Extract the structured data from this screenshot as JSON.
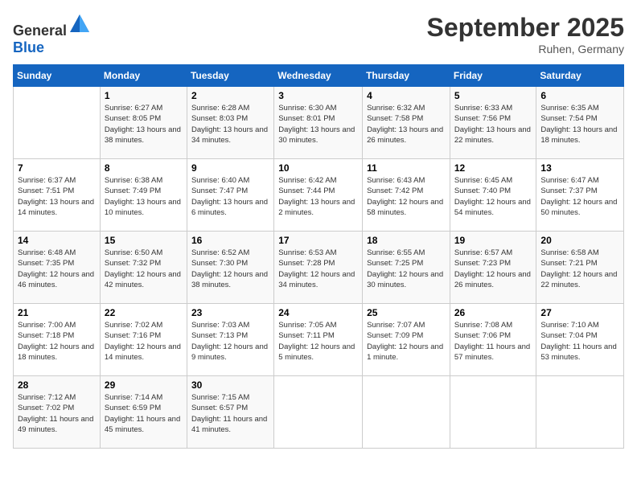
{
  "header": {
    "logo_general": "General",
    "logo_blue": "Blue",
    "month": "September 2025",
    "location": "Ruhen, Germany"
  },
  "days_of_week": [
    "Sunday",
    "Monday",
    "Tuesday",
    "Wednesday",
    "Thursday",
    "Friday",
    "Saturday"
  ],
  "weeks": [
    [
      {
        "day": "",
        "sunrise": "",
        "sunset": "",
        "daylight": ""
      },
      {
        "day": "1",
        "sunrise": "Sunrise: 6:27 AM",
        "sunset": "Sunset: 8:05 PM",
        "daylight": "Daylight: 13 hours and 38 minutes."
      },
      {
        "day": "2",
        "sunrise": "Sunrise: 6:28 AM",
        "sunset": "Sunset: 8:03 PM",
        "daylight": "Daylight: 13 hours and 34 minutes."
      },
      {
        "day": "3",
        "sunrise": "Sunrise: 6:30 AM",
        "sunset": "Sunset: 8:01 PM",
        "daylight": "Daylight: 13 hours and 30 minutes."
      },
      {
        "day": "4",
        "sunrise": "Sunrise: 6:32 AM",
        "sunset": "Sunset: 7:58 PM",
        "daylight": "Daylight: 13 hours and 26 minutes."
      },
      {
        "day": "5",
        "sunrise": "Sunrise: 6:33 AM",
        "sunset": "Sunset: 7:56 PM",
        "daylight": "Daylight: 13 hours and 22 minutes."
      },
      {
        "day": "6",
        "sunrise": "Sunrise: 6:35 AM",
        "sunset": "Sunset: 7:54 PM",
        "daylight": "Daylight: 13 hours and 18 minutes."
      }
    ],
    [
      {
        "day": "7",
        "sunrise": "Sunrise: 6:37 AM",
        "sunset": "Sunset: 7:51 PM",
        "daylight": "Daylight: 13 hours and 14 minutes."
      },
      {
        "day": "8",
        "sunrise": "Sunrise: 6:38 AM",
        "sunset": "Sunset: 7:49 PM",
        "daylight": "Daylight: 13 hours and 10 minutes."
      },
      {
        "day": "9",
        "sunrise": "Sunrise: 6:40 AM",
        "sunset": "Sunset: 7:47 PM",
        "daylight": "Daylight: 13 hours and 6 minutes."
      },
      {
        "day": "10",
        "sunrise": "Sunrise: 6:42 AM",
        "sunset": "Sunset: 7:44 PM",
        "daylight": "Daylight: 13 hours and 2 minutes."
      },
      {
        "day": "11",
        "sunrise": "Sunrise: 6:43 AM",
        "sunset": "Sunset: 7:42 PM",
        "daylight": "Daylight: 12 hours and 58 minutes."
      },
      {
        "day": "12",
        "sunrise": "Sunrise: 6:45 AM",
        "sunset": "Sunset: 7:40 PM",
        "daylight": "Daylight: 12 hours and 54 minutes."
      },
      {
        "day": "13",
        "sunrise": "Sunrise: 6:47 AM",
        "sunset": "Sunset: 7:37 PM",
        "daylight": "Daylight: 12 hours and 50 minutes."
      }
    ],
    [
      {
        "day": "14",
        "sunrise": "Sunrise: 6:48 AM",
        "sunset": "Sunset: 7:35 PM",
        "daylight": "Daylight: 12 hours and 46 minutes."
      },
      {
        "day": "15",
        "sunrise": "Sunrise: 6:50 AM",
        "sunset": "Sunset: 7:32 PM",
        "daylight": "Daylight: 12 hours and 42 minutes."
      },
      {
        "day": "16",
        "sunrise": "Sunrise: 6:52 AM",
        "sunset": "Sunset: 7:30 PM",
        "daylight": "Daylight: 12 hours and 38 minutes."
      },
      {
        "day": "17",
        "sunrise": "Sunrise: 6:53 AM",
        "sunset": "Sunset: 7:28 PM",
        "daylight": "Daylight: 12 hours and 34 minutes."
      },
      {
        "day": "18",
        "sunrise": "Sunrise: 6:55 AM",
        "sunset": "Sunset: 7:25 PM",
        "daylight": "Daylight: 12 hours and 30 minutes."
      },
      {
        "day": "19",
        "sunrise": "Sunrise: 6:57 AM",
        "sunset": "Sunset: 7:23 PM",
        "daylight": "Daylight: 12 hours and 26 minutes."
      },
      {
        "day": "20",
        "sunrise": "Sunrise: 6:58 AM",
        "sunset": "Sunset: 7:21 PM",
        "daylight": "Daylight: 12 hours and 22 minutes."
      }
    ],
    [
      {
        "day": "21",
        "sunrise": "Sunrise: 7:00 AM",
        "sunset": "Sunset: 7:18 PM",
        "daylight": "Daylight: 12 hours and 18 minutes."
      },
      {
        "day": "22",
        "sunrise": "Sunrise: 7:02 AM",
        "sunset": "Sunset: 7:16 PM",
        "daylight": "Daylight: 12 hours and 14 minutes."
      },
      {
        "day": "23",
        "sunrise": "Sunrise: 7:03 AM",
        "sunset": "Sunset: 7:13 PM",
        "daylight": "Daylight: 12 hours and 9 minutes."
      },
      {
        "day": "24",
        "sunrise": "Sunrise: 7:05 AM",
        "sunset": "Sunset: 7:11 PM",
        "daylight": "Daylight: 12 hours and 5 minutes."
      },
      {
        "day": "25",
        "sunrise": "Sunrise: 7:07 AM",
        "sunset": "Sunset: 7:09 PM",
        "daylight": "Daylight: 12 hours and 1 minute."
      },
      {
        "day": "26",
        "sunrise": "Sunrise: 7:08 AM",
        "sunset": "Sunset: 7:06 PM",
        "daylight": "Daylight: 11 hours and 57 minutes."
      },
      {
        "day": "27",
        "sunrise": "Sunrise: 7:10 AM",
        "sunset": "Sunset: 7:04 PM",
        "daylight": "Daylight: 11 hours and 53 minutes."
      }
    ],
    [
      {
        "day": "28",
        "sunrise": "Sunrise: 7:12 AM",
        "sunset": "Sunset: 7:02 PM",
        "daylight": "Daylight: 11 hours and 49 minutes."
      },
      {
        "day": "29",
        "sunrise": "Sunrise: 7:14 AM",
        "sunset": "Sunset: 6:59 PM",
        "daylight": "Daylight: 11 hours and 45 minutes."
      },
      {
        "day": "30",
        "sunrise": "Sunrise: 7:15 AM",
        "sunset": "Sunset: 6:57 PM",
        "daylight": "Daylight: 11 hours and 41 minutes."
      },
      {
        "day": "",
        "sunrise": "",
        "sunset": "",
        "daylight": ""
      },
      {
        "day": "",
        "sunrise": "",
        "sunset": "",
        "daylight": ""
      },
      {
        "day": "",
        "sunrise": "",
        "sunset": "",
        "daylight": ""
      },
      {
        "day": "",
        "sunrise": "",
        "sunset": "",
        "daylight": ""
      }
    ]
  ]
}
